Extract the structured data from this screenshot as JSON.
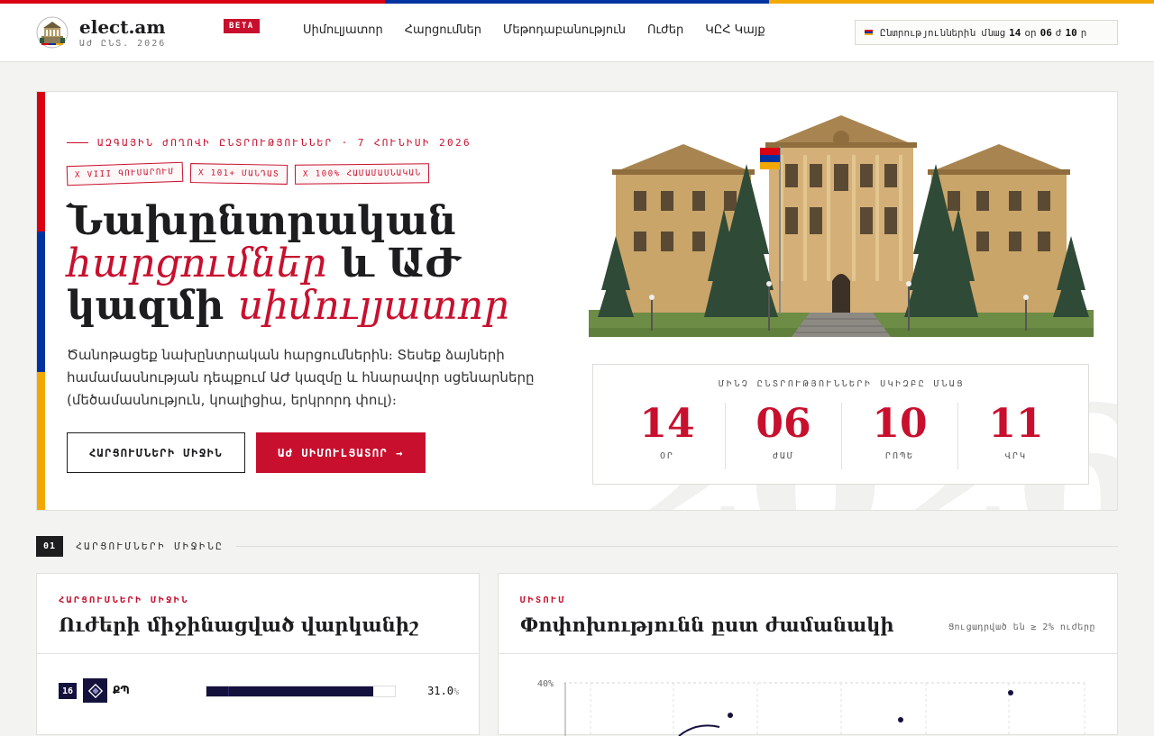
{
  "colors": {
    "red": "#d90012",
    "blue": "#0033a0",
    "orange": "#f2a800",
    "accent": "#c8102e",
    "navy": "#14123d"
  },
  "header": {
    "brand": "elect.am",
    "brand_sub": "ԱԺ ԸՆՏ. 2026",
    "beta": "BETA",
    "nav": [
      "Սիմուլյատոր",
      "Հարցումներ",
      "Մեթոդաբանություն",
      "Ուժեր",
      "ԿԸՀ Կայք"
    ],
    "countdown": {
      "prefix": "Ընտրություններին մնաց",
      "days": "14",
      "days_unit": "օր",
      "hours": "06",
      "hours_unit": "ժ",
      "minutes": "10",
      "minutes_unit": "ր"
    }
  },
  "hero": {
    "eyebrow": "ԱԶԳԱՅԻՆ ԺՈՂՈՎԻ ԸՆՏՐՈՒԹՅՈՒՆՆԵՐ · 7 ՀՈՒՆԻՍԻ 2026",
    "stamps": [
      "Х VIII ԳՈՒՄԱՐՈՒՄ",
      "Х 101+ ՄԱՆԴԱՏ",
      "Х 100% ՀԱՄԱՄԱՍՆԱԿԱՆ"
    ],
    "title_1": "Նախընտրական",
    "title_2_em": "հարցումներ",
    "title_2_rest": " և ԱԺ",
    "title_3": "կազմի ",
    "title_3_em": "սիմուլյատոր",
    "lede": "Ծանոթացեք նախընտրական հարցումներին։ Տեսեք ձայների համամասնության դեպքում ԱԺ կազմը և հնարավոր սցենարները (մեծամասնություն, կոալիցիա, երկրորդ փուլ)։",
    "btn_polls": "ՀԱՐՑՈՒՄՆԵՐԻ ՄԻՋԻՆ",
    "btn_sim": "ԱԺ ՍԻՄՈՒԼՅԱՏՈՐ →",
    "watermark": "2026",
    "timer": {
      "title": "ՄԻՆՉ ԸՆՏՐՈՒԹՅՈՒՆՆԵՐԻ ՍԿԻԶԲԸ ՄՆԱՑ",
      "cells": [
        {
          "value": "14",
          "label": "ՕՐ"
        },
        {
          "value": "06",
          "label": "ԺԱՄ"
        },
        {
          "value": "10",
          "label": "ՐՈՊԵ"
        },
        {
          "value": "11",
          "label": "ՎՐԿ"
        }
      ]
    }
  },
  "section": {
    "num": "01",
    "label": "ՀԱՐՑՈՒՄՆԵՐԻ ՄԻՋԻՆԸ"
  },
  "polls": {
    "kicker": "ՀԱՐՑՈՒՄՆԵՐԻ ՄԻՋԻՆ",
    "title": "Ուժերի միջինացված վարկանիշ",
    "rows": [
      {
        "rank": "16",
        "name": "ՔՊ",
        "value": "31.0",
        "unit": "%",
        "fraction": 0.885
      }
    ]
  },
  "trend": {
    "kicker": "ՄԻՏՈՒՄ",
    "title": "Փոփոխությունն ըստ ժամանակի",
    "note": "Ցուցադրված են ≥ 2% ուժերը",
    "ytick": "40%"
  }
}
